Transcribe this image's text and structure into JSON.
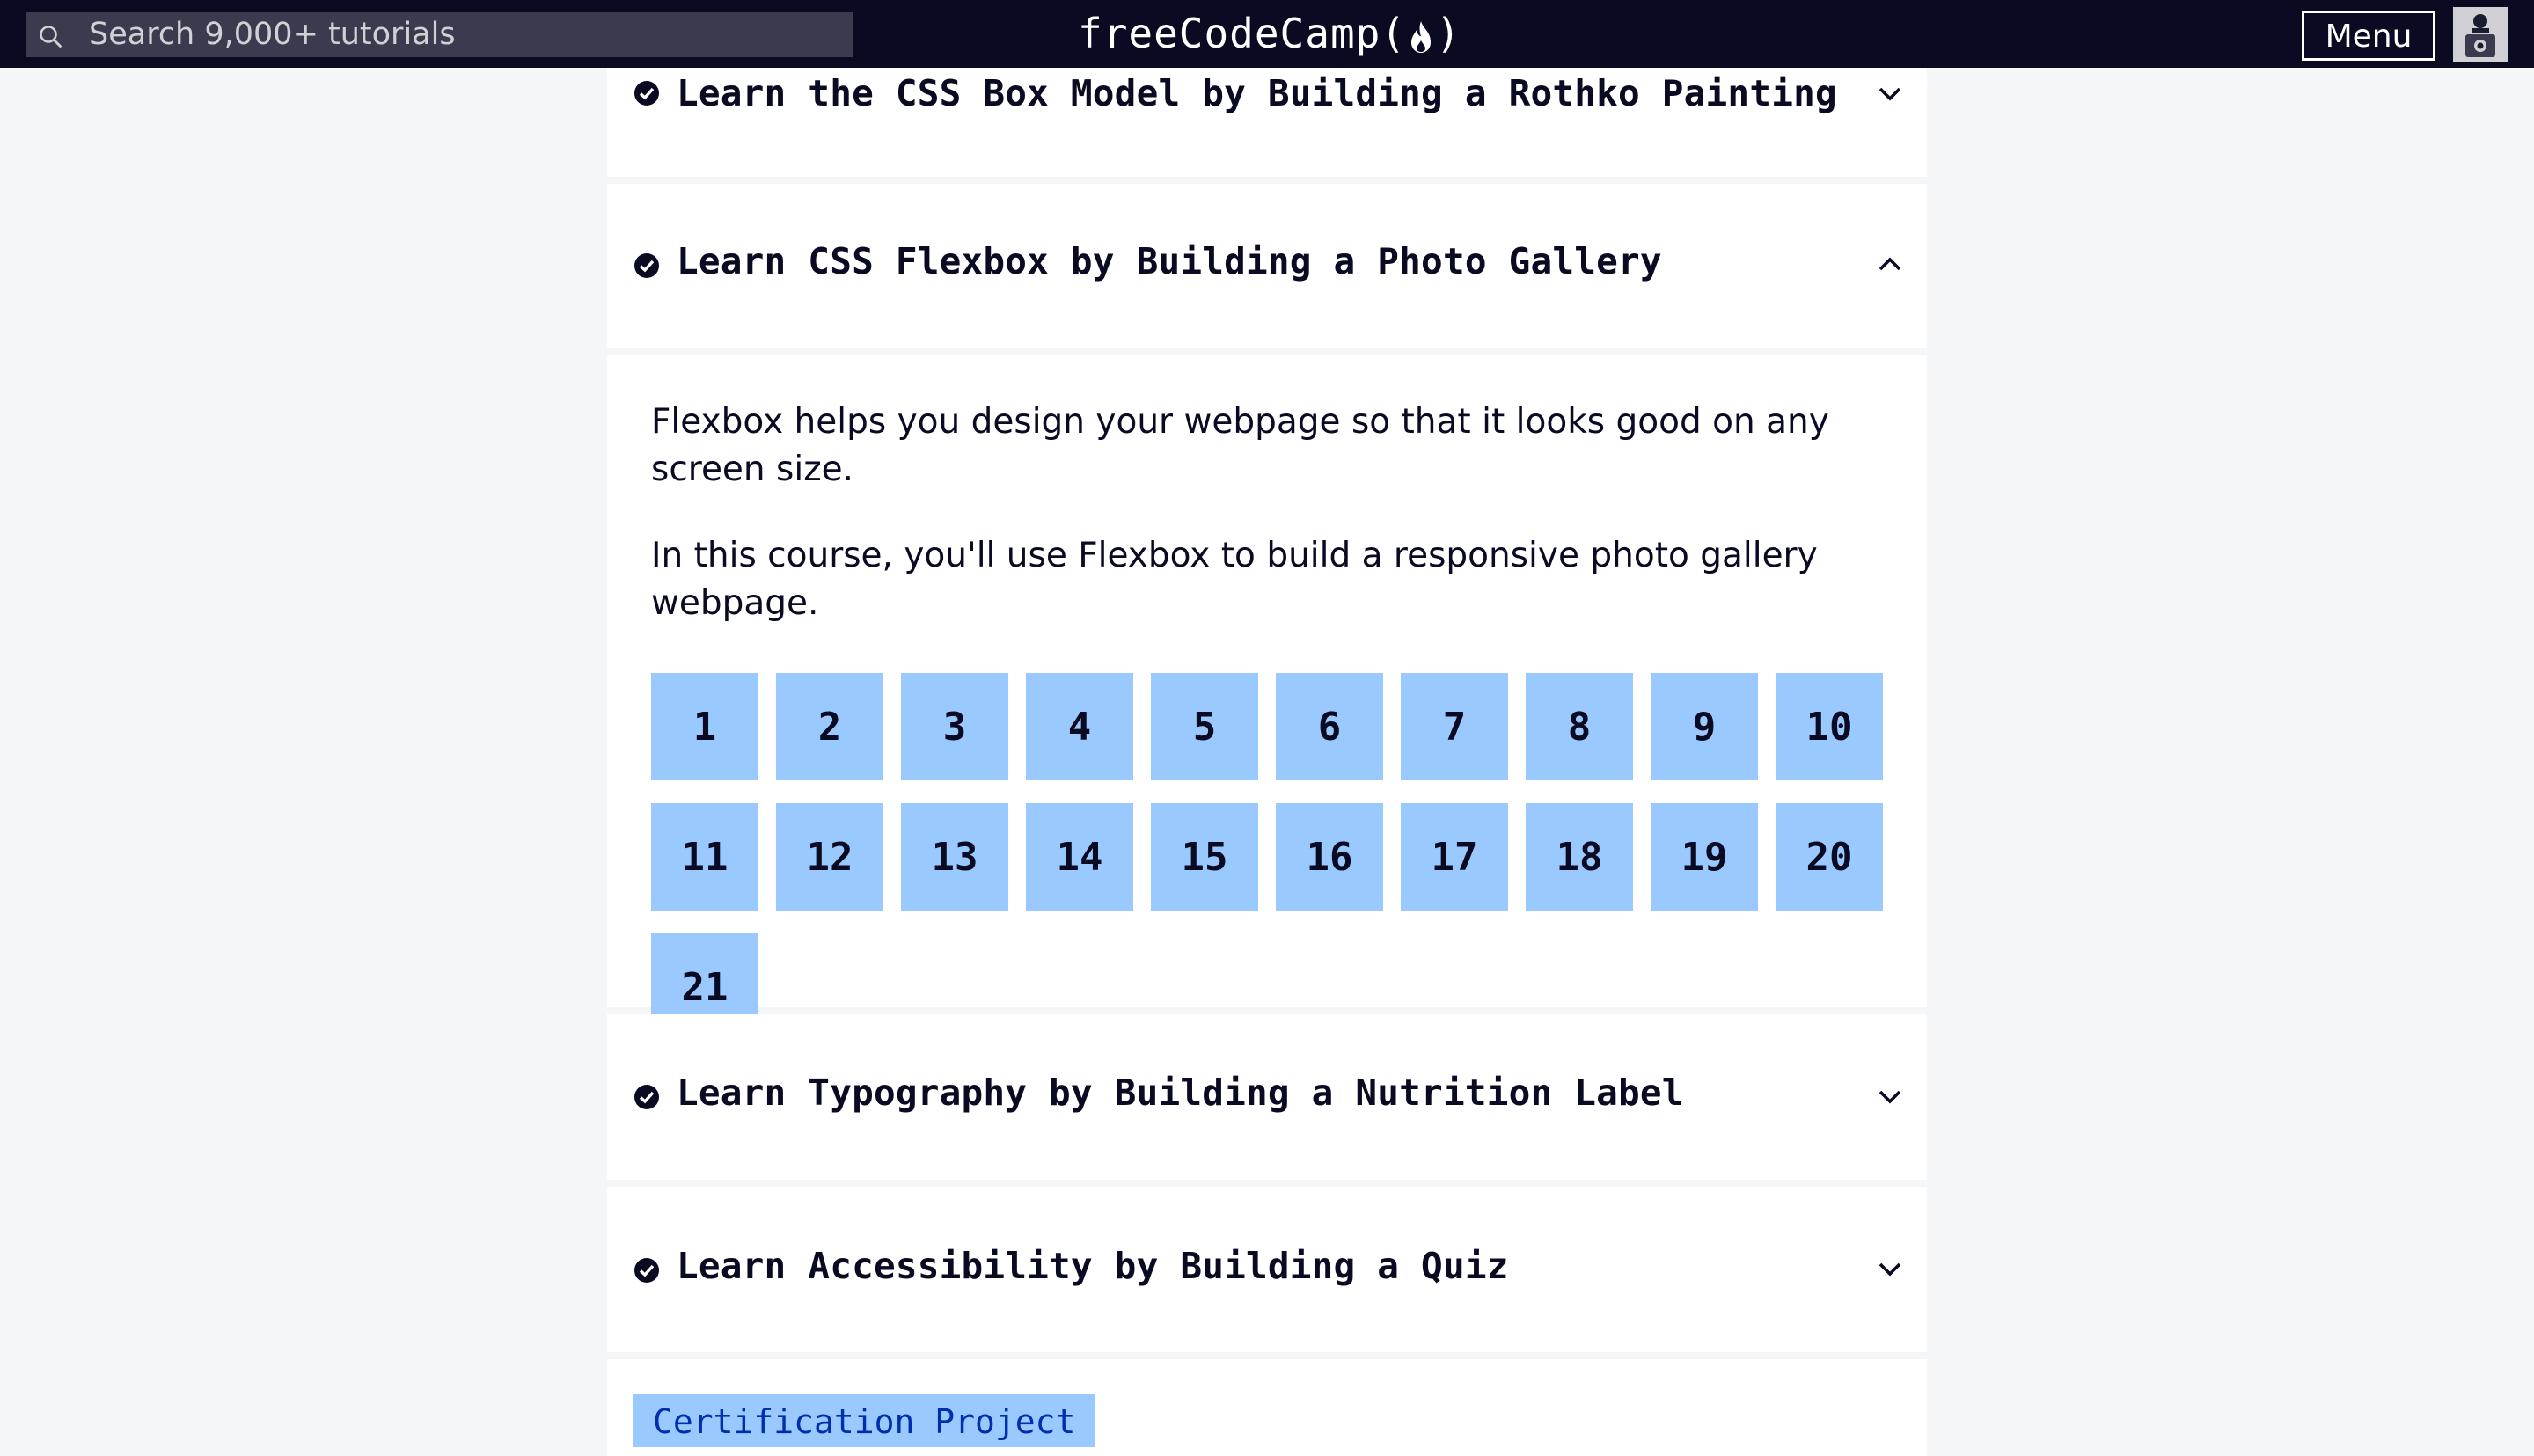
{
  "navbar": {
    "search_placeholder": "Search 9,000+ tutorials",
    "logo_text_left": "freeCodeCamp(",
    "logo_text_right": ")",
    "menu_label": "Menu"
  },
  "blocks": [
    {
      "title": "Learn the CSS Box Model by Building a Rothko Painting",
      "expanded": false
    },
    {
      "title": "Learn CSS Flexbox by Building a Photo Gallery",
      "expanded": true
    },
    {
      "title": "Learn Typography by Building a Nutrition Label",
      "expanded": false
    },
    {
      "title": "Learn Accessibility by Building a Quiz",
      "expanded": false
    }
  ],
  "expanded_block": {
    "description_1": "Flexbox helps you design your webpage so that it looks good on any screen size.",
    "description_2": "In this course, you'll use Flexbox to build a responsive photo gallery webpage.",
    "steps": [
      "1",
      "2",
      "3",
      "4",
      "5",
      "6",
      "7",
      "8",
      "9",
      "10",
      "11",
      "12",
      "13",
      "14",
      "15",
      "16",
      "17",
      "18",
      "19",
      "20",
      "21"
    ]
  },
  "certification": {
    "label": "Certification Project"
  },
  "colors": {
    "navbar_bg": "#0a0a23",
    "search_bg": "#3b3b4f",
    "step_bg": "#99c9ff",
    "page_bg": "#f5f6f7"
  }
}
